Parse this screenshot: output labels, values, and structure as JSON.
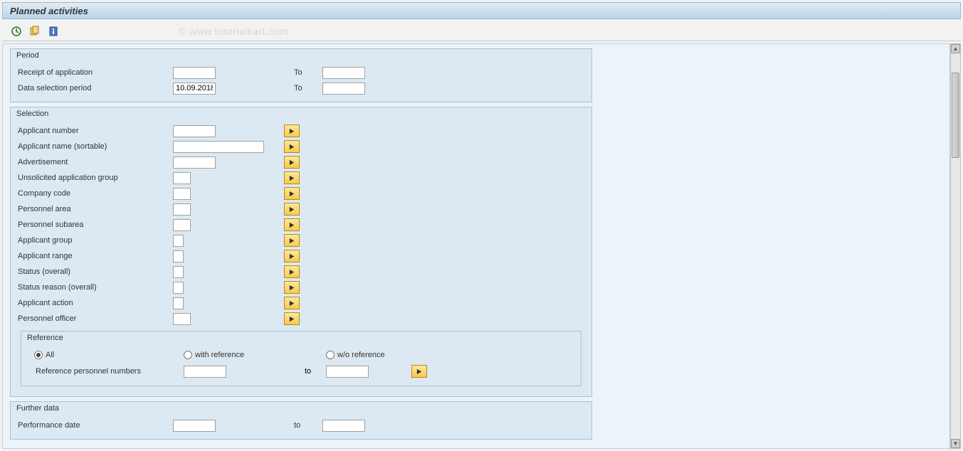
{
  "title": "Planned activities",
  "watermark": "© www.tutorialkart.com",
  "period": {
    "title": "Period",
    "receipt_label": "Receipt of application",
    "receipt_from": "",
    "receipt_to_label": "To",
    "receipt_to": "",
    "data_sel_label": "Data selection period",
    "data_sel_from": "10.09.2018",
    "data_sel_to_label": "To",
    "data_sel_to": ""
  },
  "selection": {
    "title": "Selection",
    "rows": [
      {
        "label": "Applicant number",
        "value": "",
        "width": "w60"
      },
      {
        "label": "Applicant name (sortable)",
        "value": "",
        "width": "w120"
      },
      {
        "label": "Advertisement",
        "value": "",
        "width": "w60"
      },
      {
        "label": "Unsolicited application group",
        "value": "",
        "width": "w25"
      },
      {
        "label": "Company code",
        "value": "",
        "width": "w25"
      },
      {
        "label": "Personnel area",
        "value": "",
        "width": "w25"
      },
      {
        "label": "Personnel subarea",
        "value": "",
        "width": "w25"
      },
      {
        "label": "Applicant group",
        "value": "",
        "width": "w15"
      },
      {
        "label": "Applicant range",
        "value": "",
        "width": "w15"
      },
      {
        "label": "Status (overall)",
        "value": "",
        "width": "w15"
      },
      {
        "label": "Status reason (overall)",
        "value": "",
        "width": "w15"
      },
      {
        "label": "Applicant action",
        "value": "",
        "width": "w15"
      },
      {
        "label": "Personnel officer",
        "value": "",
        "width": "w25"
      }
    ],
    "reference": {
      "title": "Reference",
      "option_all": "All",
      "option_with": "with reference",
      "option_wo": "w/o reference",
      "ref_pers_label": "Reference personnel numbers",
      "ref_pers_from": "",
      "ref_pers_to_label": "to",
      "ref_pers_to": ""
    }
  },
  "further": {
    "title": "Further data",
    "perf_label": "Performance date",
    "perf_from": "",
    "perf_to_label": "to",
    "perf_to": ""
  }
}
